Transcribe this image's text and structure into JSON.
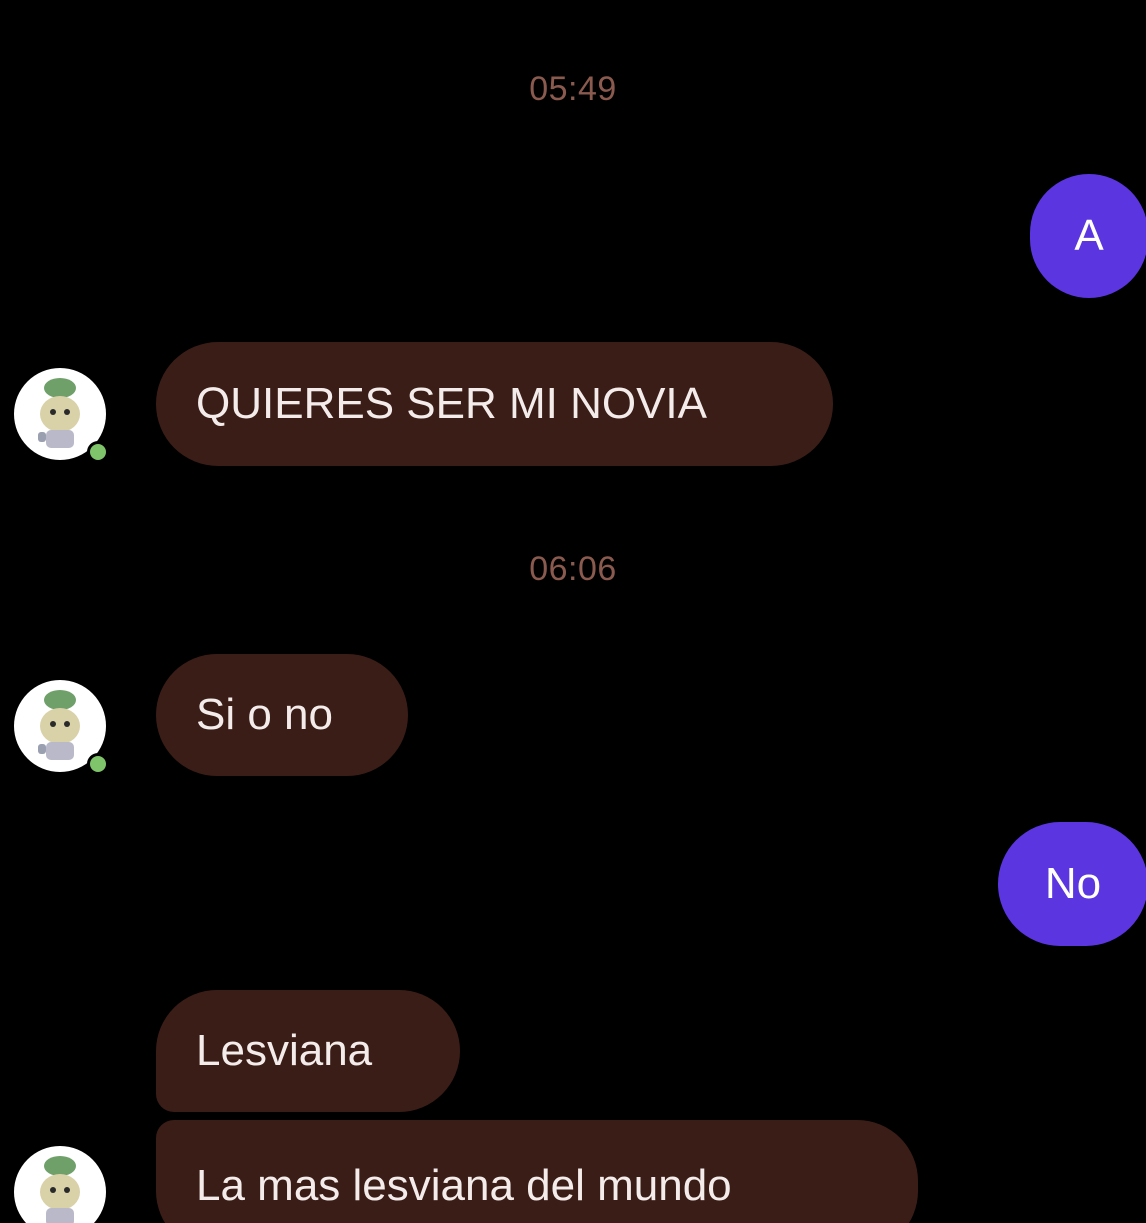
{
  "chat": {
    "timestamps": [
      "05:49",
      "06:06"
    ],
    "messages": [
      {
        "sender": "other",
        "text": "QUIERES SER MI NOVIA"
      },
      {
        "sender": "other",
        "text": "Si o no"
      },
      {
        "sender": "other",
        "text": "Lesviana"
      },
      {
        "sender": "other",
        "text": "La mas lesviana del mundo"
      }
    ],
    "sent": [
      {
        "text": "A"
      },
      {
        "text": "No"
      }
    ],
    "avatar_icon": "cartoon-character-avatar-icon",
    "online_indicator_icon": "online-status-dot-icon"
  },
  "colors": {
    "background": "#000000",
    "incoming_bubble": "#3b1d17",
    "outgoing_bubble": "#5a35e0",
    "timestamp_text": "#8a5a4e",
    "online_dot": "#7fc46a"
  }
}
